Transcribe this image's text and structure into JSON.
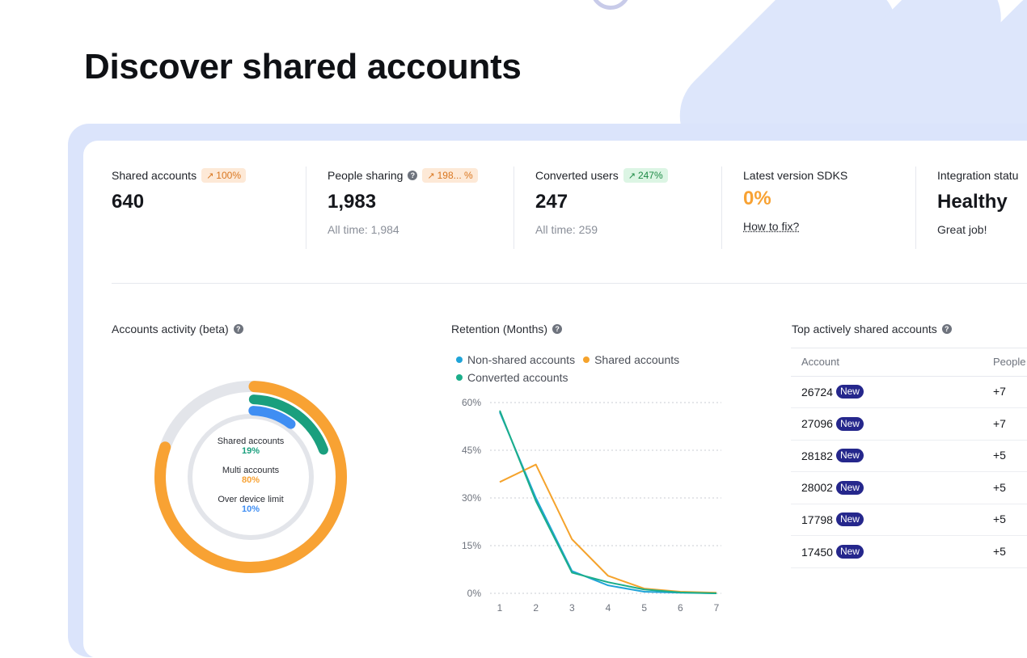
{
  "page": {
    "title": "Discover shared accounts"
  },
  "colors": {
    "accent_orange": "#f8a233",
    "accent_teal": "#1a9f7e",
    "accent_blue": "#3f8ef3",
    "new_badge": "#25278c",
    "card_frame": "#dbe4fb"
  },
  "stats": [
    {
      "label": "Shared accounts",
      "badge": "100%",
      "badge_icon": "trend-up-icon",
      "badge_color": "orange",
      "value": "640"
    },
    {
      "label": "People sharing",
      "help_icon": "help-icon",
      "badge": "198... %",
      "badge_icon": "trend-up-icon",
      "badge_color": "orange",
      "value": "1,983",
      "sub": "All time: 1,984"
    },
    {
      "label": "Converted users",
      "badge": "247%",
      "badge_icon": "trend-up-icon",
      "badge_color": "green",
      "value": "247",
      "sub": "All time: 259"
    },
    {
      "label": "Latest version SDKS",
      "value": "0%",
      "value_color": "#f8a233",
      "link": "How to fix?"
    },
    {
      "label": "Integration statu",
      "value": "Healthy",
      "sub": "Great job!"
    }
  ],
  "activity": {
    "title": "Accounts activity (beta)",
    "segments": [
      {
        "label": "Shared accounts",
        "value": "19%",
        "fraction": 0.19,
        "color": "#1a9f7e"
      },
      {
        "label": "Multi accounts",
        "value": "80%",
        "fraction": 0.8,
        "color": "#f8a233"
      },
      {
        "label": "Over device limit",
        "value": "10%",
        "fraction": 0.1,
        "color": "#3f8ef3"
      }
    ]
  },
  "retention": {
    "title": "Retention (Months)",
    "legend": [
      "Non-shared accounts",
      "Shared accounts",
      "Converted accounts"
    ]
  },
  "chart_data": {
    "type": "line",
    "x": [
      1,
      2,
      3,
      4,
      5,
      6,
      7
    ],
    "ylim": [
      0,
      60
    ],
    "yticks": [
      "0%",
      "15%",
      "30%",
      "45%",
      "60%"
    ],
    "ytick_values": [
      0,
      15,
      30,
      45,
      60
    ],
    "grid": true,
    "legend_position": "top-left",
    "series": [
      {
        "name": "Non-shared accounts",
        "color": "#20a4d8",
        "values": [
          57,
          30,
          7,
          2.5,
          0.5,
          0.2,
          0
        ]
      },
      {
        "name": "Shared accounts",
        "color": "#f5a32c",
        "values": [
          35,
          40.5,
          17,
          5.5,
          1.5,
          0.5,
          0.2
        ]
      },
      {
        "name": "Converted accounts",
        "color": "#1cae8a",
        "values": [
          57.5,
          29,
          6.5,
          3.5,
          1.2,
          0.3,
          0
        ]
      }
    ]
  },
  "top_accounts": {
    "title": "Top actively shared accounts",
    "columns": [
      "Account",
      "People"
    ],
    "rows": [
      {
        "account": "26724",
        "badge": "New",
        "people": "+7"
      },
      {
        "account": "27096",
        "badge": "New",
        "people": "+7"
      },
      {
        "account": "28182",
        "badge": "New",
        "people": "+5"
      },
      {
        "account": "28002",
        "badge": "New",
        "people": "+5"
      },
      {
        "account": "17798",
        "badge": "New",
        "people": "+5"
      },
      {
        "account": "17450",
        "badge": "New",
        "people": "+5"
      }
    ]
  }
}
